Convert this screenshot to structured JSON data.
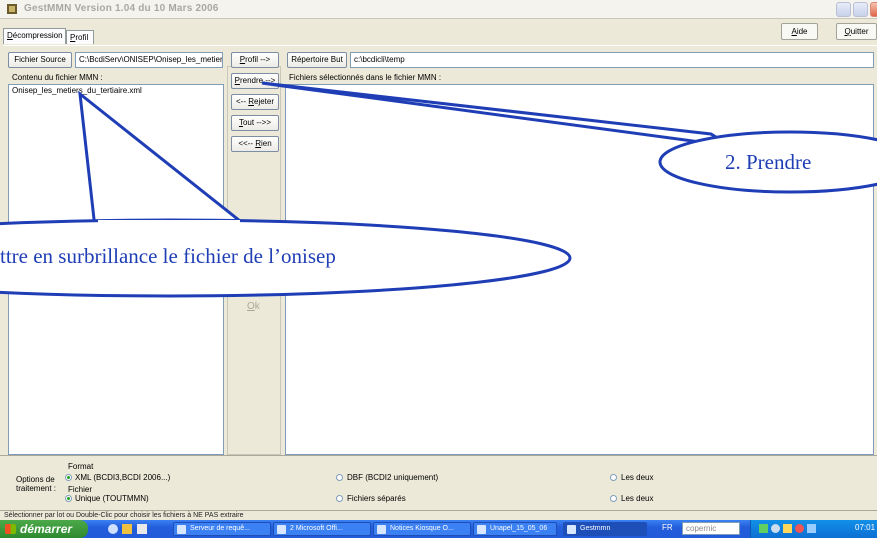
{
  "window": {
    "title": "GestMMN  Version 1.04 du 10 Mars 2006"
  },
  "tabs": [
    {
      "label_u": "D",
      "label_rest": "écompression"
    },
    {
      "label_u": "P",
      "label_rest": "rofil"
    }
  ],
  "toolbar": {
    "aide_u": "A",
    "aide_rest": "ide",
    "quitter_u": "Q",
    "quitter_rest": "uitter"
  },
  "source": {
    "button_label": "Fichier Source",
    "path_value": "C:\\BcdiServ\\ONISEP\\Onisep_les_metiers",
    "content_label": "Contenu du fichier MMN :",
    "files": [
      "Onisep_les_metiers_du_tertiaire.xml"
    ]
  },
  "actions": {
    "profil_u": "P",
    "profil_rest": "rofil -->",
    "prendre_u": "P",
    "prendre_rest": "rendre -->",
    "rejeter_pre": "<-- ",
    "rejeter_u": "R",
    "rejeter_rest": "ejeter",
    "tout_u": "T",
    "tout_rest": "out -->>",
    "rien_pre": "<<-- ",
    "rien_u": "R",
    "rien_rest": "ien",
    "ok_u": "O",
    "ok_rest": "k"
  },
  "destination": {
    "button_label": "Répertoire But",
    "path_value": "c:\\bcdicli\\temp",
    "selected_label": "Fichiers sélectionnés dans le fichier MMN :"
  },
  "options": {
    "label_line1": "Options de",
    "label_line2": "traitement :",
    "format": {
      "title": "Format",
      "choices": [
        "XML (BCDI3,BCDI 2006...)",
        "DBF (BCDI2 uniquement)",
        "Les deux"
      ],
      "selected_index": 0
    },
    "fichier": {
      "title": "Fichier",
      "choices": [
        "Unique (TOUTMMN)",
        "Fichiers séparés",
        "Les deux"
      ],
      "selected_index": 0
    }
  },
  "status": {
    "text": "Sélectionner par lot ou Double-Clic pour choisir les fichiers à NE PAS extraire"
  },
  "taskbar": {
    "start_label": "démarrer",
    "items": [
      "Serveur de requê...",
      "2 Microsoft Offi...",
      "Notices Kiosque O...",
      "Unapel_15_05_06",
      "Gestmmn"
    ],
    "language": "FR",
    "search_placeholder": "copernic",
    "clock": "07:01"
  },
  "annotations": {
    "callout_prendre": "2. Prendre",
    "callout_select": "ttre en surbrillance le fichier de l’onisep"
  },
  "colors": {
    "annotation_blue": "#1f3eb6",
    "window_bg": "#ece9d8",
    "taskbar_blue": "#245edb",
    "start_green": "#3c9a3a"
  }
}
